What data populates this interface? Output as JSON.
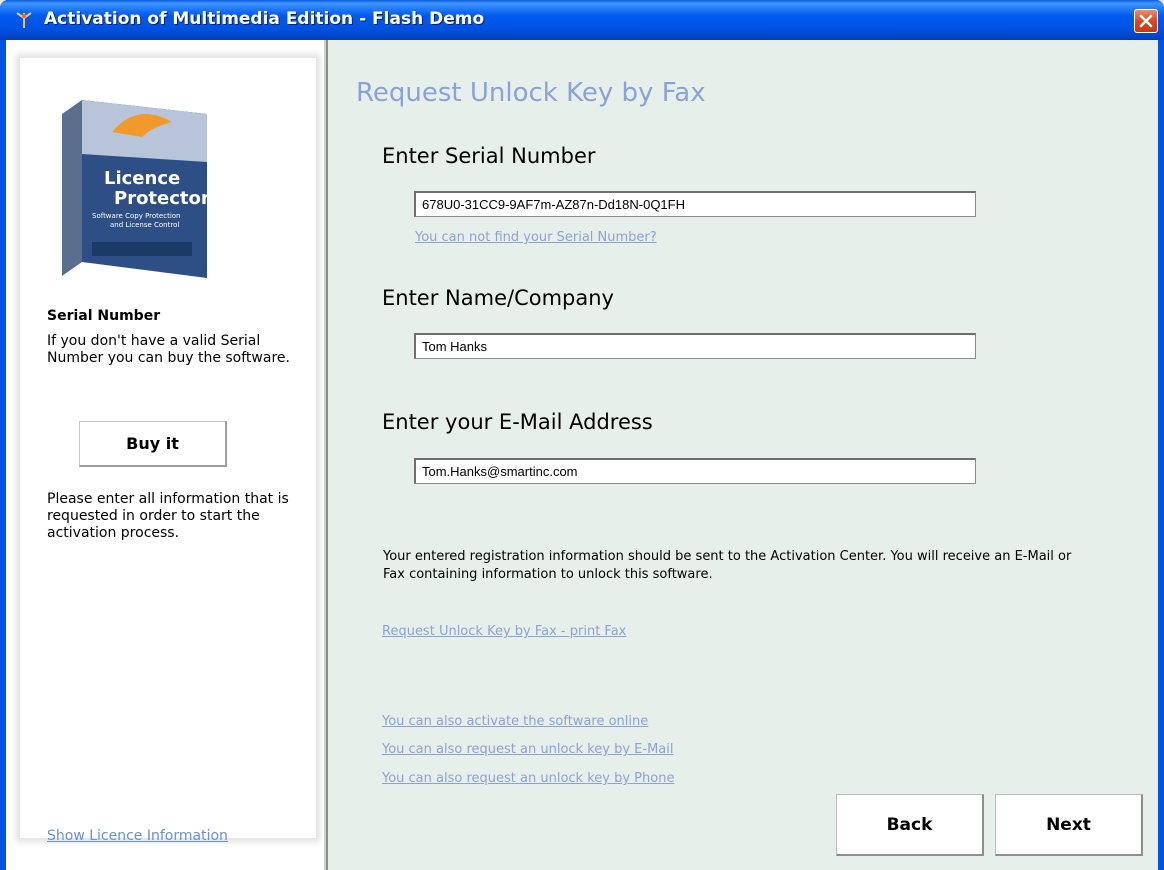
{
  "window": {
    "title": "Activation of Multimedia Edition - Flash Demo"
  },
  "sidebar": {
    "heading": "Serial Number",
    "text_1_line1": "If you don't have a valid Serial",
    "text_1_line2": "Number you can buy the software.",
    "buy_label": "Buy it",
    "text_2_line1": "Please enter all information that is",
    "text_2_line2": "requested in order to start the",
    "text_2_line3": "activation process.",
    "licence_link": "Show Licence Information",
    "product_box": {
      "title_line1": "Licence",
      "title_line2": "Protector",
      "subtitle_line1": "Software Copy Protection",
      "subtitle_line2": "and License Control"
    }
  },
  "main": {
    "title": "Request Unlock Key by Fax",
    "serial": {
      "label": "Enter Serial Number",
      "value": "678U0-31CC9-9AF7m-AZ87n-Dd18N-0Q1FH",
      "help_link": "You can not find your Serial Number?"
    },
    "name": {
      "label": "Enter Name/Company",
      "value": "Tom Hanks"
    },
    "email": {
      "label": "Enter your E-Mail Address",
      "value": "Tom.Hanks@smartinc.com"
    },
    "info_line1": "Your entered registration information should be sent to the Activation Center. You will receive an E-Mail or",
    "info_line2": "Fax containing information to unlock this software.",
    "print_fax_link": "Request Unlock Key by Fax - print Fax",
    "alt_online_link": "You can also activate the software online",
    "alt_email_link": "You can also request an unlock key by E-Mail",
    "alt_phone_link": "You can also request an unlock key by Phone",
    "back_label": "Back",
    "next_label": "Next"
  },
  "colors": {
    "titlebar": "#0054e3",
    "link": "#8aa3d7",
    "content_bg": "#e7efea"
  }
}
